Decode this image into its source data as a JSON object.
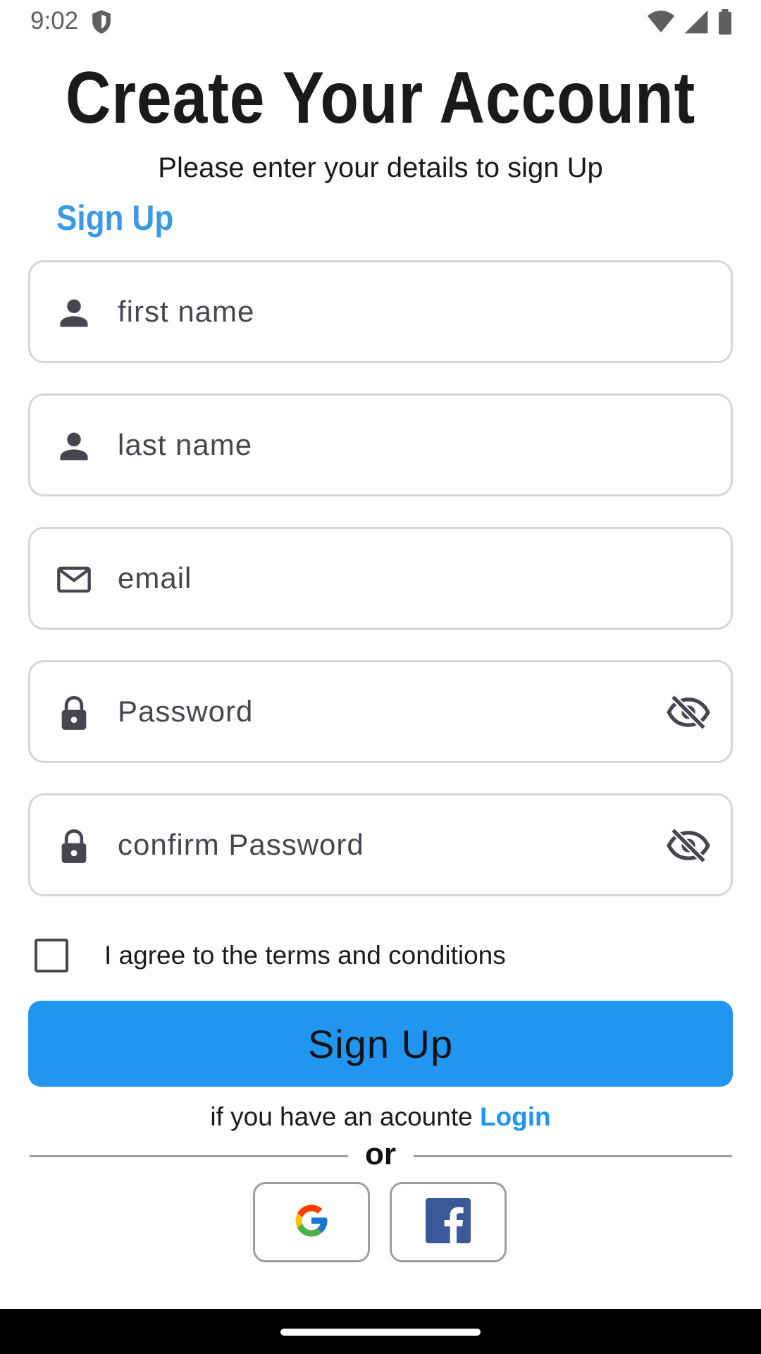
{
  "status_bar": {
    "time": "9:02",
    "icons": [
      "shield-icon",
      "wifi-icon",
      "signal-icon",
      "battery-icon"
    ]
  },
  "header": {
    "title": "Create Your Account",
    "subtitle": "Please enter your details to sign Up",
    "section_label": "Sign Up"
  },
  "form": {
    "first_name": {
      "placeholder": "first name",
      "value": "",
      "icon": "person-icon"
    },
    "last_name": {
      "placeholder": "last name",
      "value": "",
      "icon": "person-icon"
    },
    "email": {
      "placeholder": "email",
      "value": "",
      "icon": "mail-icon"
    },
    "password": {
      "placeholder": "Password",
      "value": "",
      "icon": "lock-icon",
      "toggle_icon": "eye-off-icon"
    },
    "confirm_password": {
      "placeholder": "confirm Password",
      "value": "",
      "icon": "lock-icon",
      "toggle_icon": "eye-off-icon"
    },
    "terms": {
      "label": "I agree to the terms and conditions",
      "checked": false
    },
    "submit_label": "Sign Up"
  },
  "footer": {
    "login_prompt": "if you have an acounte",
    "login_link": "Login",
    "divider_text": "or",
    "social": [
      "google-icon",
      "facebook-icon"
    ]
  },
  "colors": {
    "accent": "#2196f0",
    "section_label": "#3b98e5",
    "field_border": "#d6d6d6",
    "facebook": "#3b5998"
  }
}
